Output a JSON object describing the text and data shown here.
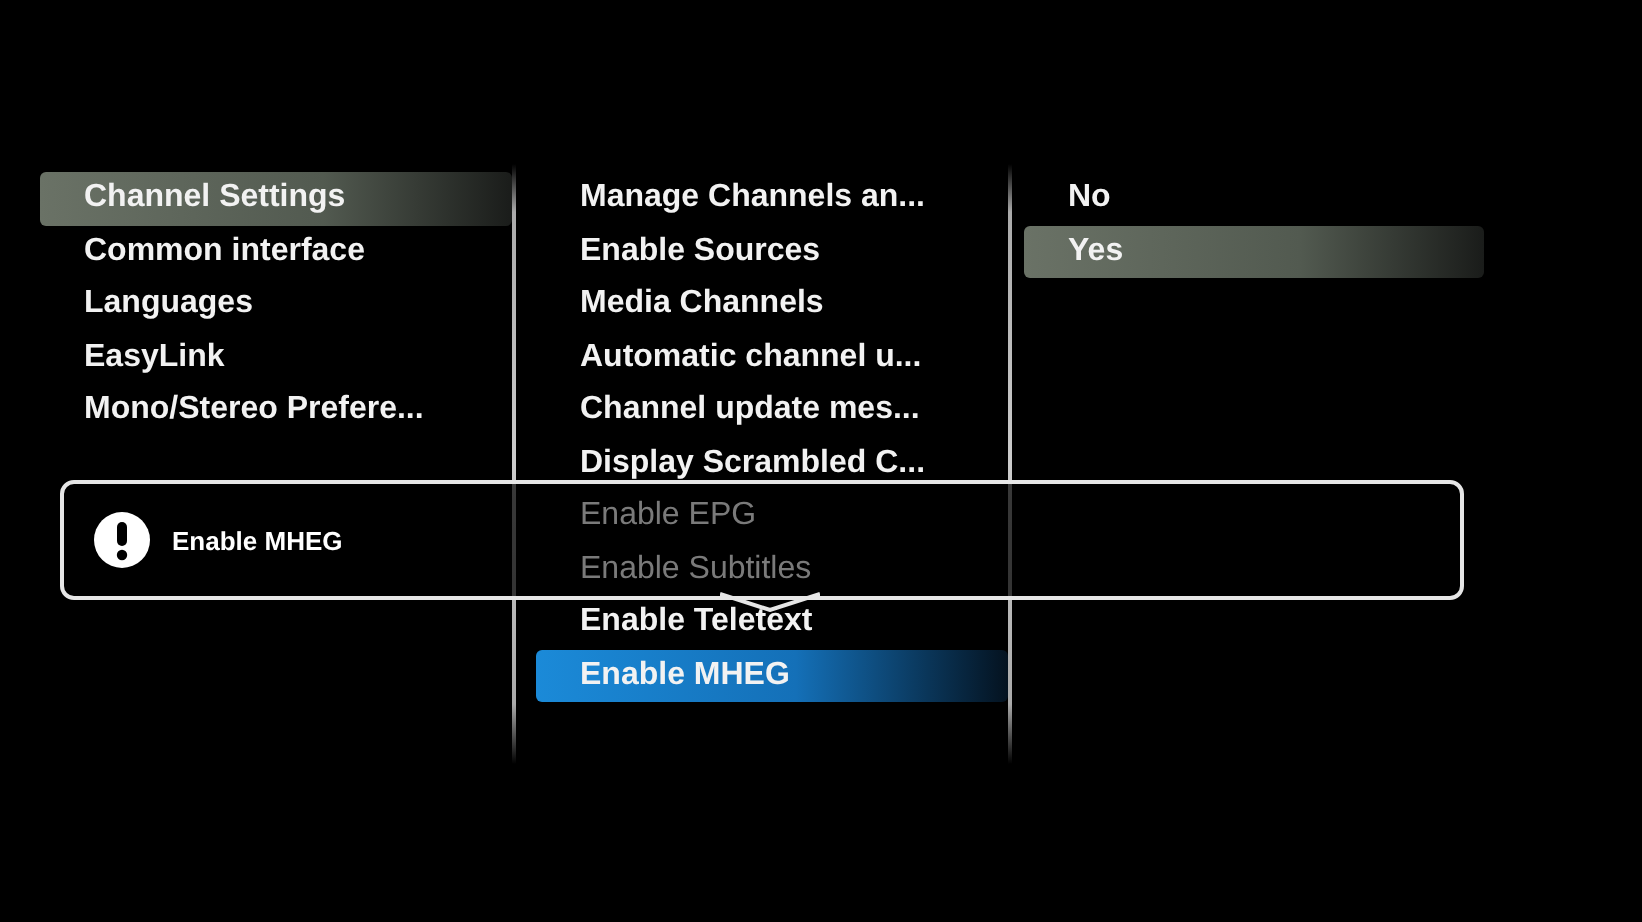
{
  "left_menu": {
    "items": [
      {
        "label": "Channel Settings",
        "selected": true
      },
      {
        "label": "Common interface",
        "selected": false
      },
      {
        "label": "Languages",
        "selected": false
      },
      {
        "label": "EasyLink",
        "selected": false
      },
      {
        "label": "Mono/Stereo Prefere...",
        "selected": false
      }
    ]
  },
  "middle_menu": {
    "items": [
      {
        "label": "Manage Channels an...",
        "selected": false,
        "disabled": false
      },
      {
        "label": "Enable Sources",
        "selected": false,
        "disabled": false
      },
      {
        "label": "Media Channels",
        "selected": false,
        "disabled": false
      },
      {
        "label": "Automatic channel u...",
        "selected": false,
        "disabled": false
      },
      {
        "label": "Channel update mes...",
        "selected": false,
        "disabled": false
      },
      {
        "label": "Display Scrambled C...",
        "selected": false,
        "disabled": false
      },
      {
        "label": "Enable EPG",
        "selected": false,
        "disabled": true
      },
      {
        "label": "Enable Subtitles",
        "selected": false,
        "disabled": true
      },
      {
        "label": "Enable Teletext",
        "selected": false,
        "disabled": false
      },
      {
        "label": "Enable MHEG",
        "selected": true,
        "disabled": false
      }
    ]
  },
  "right_menu": {
    "items": [
      {
        "label": "No",
        "selected": false
      },
      {
        "label": "Yes",
        "selected": true
      }
    ]
  },
  "info_popup": {
    "text": "Enable MHEG"
  }
}
